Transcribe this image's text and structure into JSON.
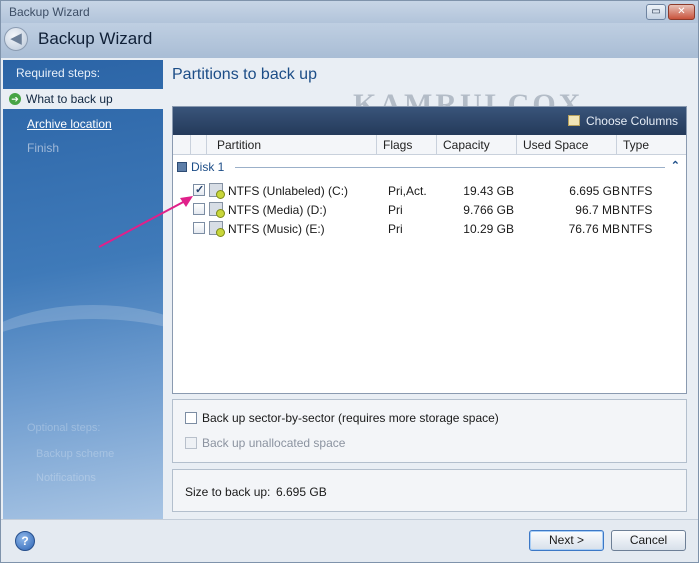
{
  "window": {
    "title": "Backup Wizard",
    "header_title": "Backup Wizard"
  },
  "sidebar": {
    "required_label": "Required steps:",
    "steps": [
      {
        "label": "What to back up",
        "state": "active"
      },
      {
        "label": "Archive location",
        "state": "link"
      },
      {
        "label": "Finish",
        "state": "disabled"
      }
    ],
    "optional_ghost": [
      "Optional steps:",
      "Backup scheme",
      "Notifications"
    ]
  },
  "main": {
    "title": "Partitions to back up",
    "watermark": "KAMRULCOX",
    "choose_columns": "Choose Columns",
    "columns": [
      "Partition",
      "Flags",
      "Capacity",
      "Used Space",
      "Type"
    ],
    "disk_label": "Disk 1",
    "partitions": [
      {
        "name": "NTFS (Unlabeled) (C:)",
        "flags": "Pri,Act.",
        "capacity": "19.43 GB",
        "used": "6.695 GB",
        "type": "NTFS",
        "checked": true
      },
      {
        "name": "NTFS (Media) (D:)",
        "flags": "Pri",
        "capacity": "9.766 GB",
        "used": "96.7 MB",
        "type": "NTFS",
        "checked": false
      },
      {
        "name": "NTFS (Music) (E:)",
        "flags": "Pri",
        "capacity": "10.29 GB",
        "used": "76.76 MB",
        "type": "NTFS",
        "checked": false
      }
    ],
    "options": {
      "sector_by_sector": "Back up sector-by-sector (requires more storage space)",
      "unallocated": "Back up unallocated space"
    },
    "size_label": "Size to back up:",
    "size_value": "6.695 GB"
  },
  "footer": {
    "next": "Next >",
    "cancel": "Cancel",
    "help": "?"
  },
  "colors": {
    "accent": "#1c4d87",
    "sidebar": "#3f7ab9",
    "annotation_arrow": "#e0208a"
  }
}
